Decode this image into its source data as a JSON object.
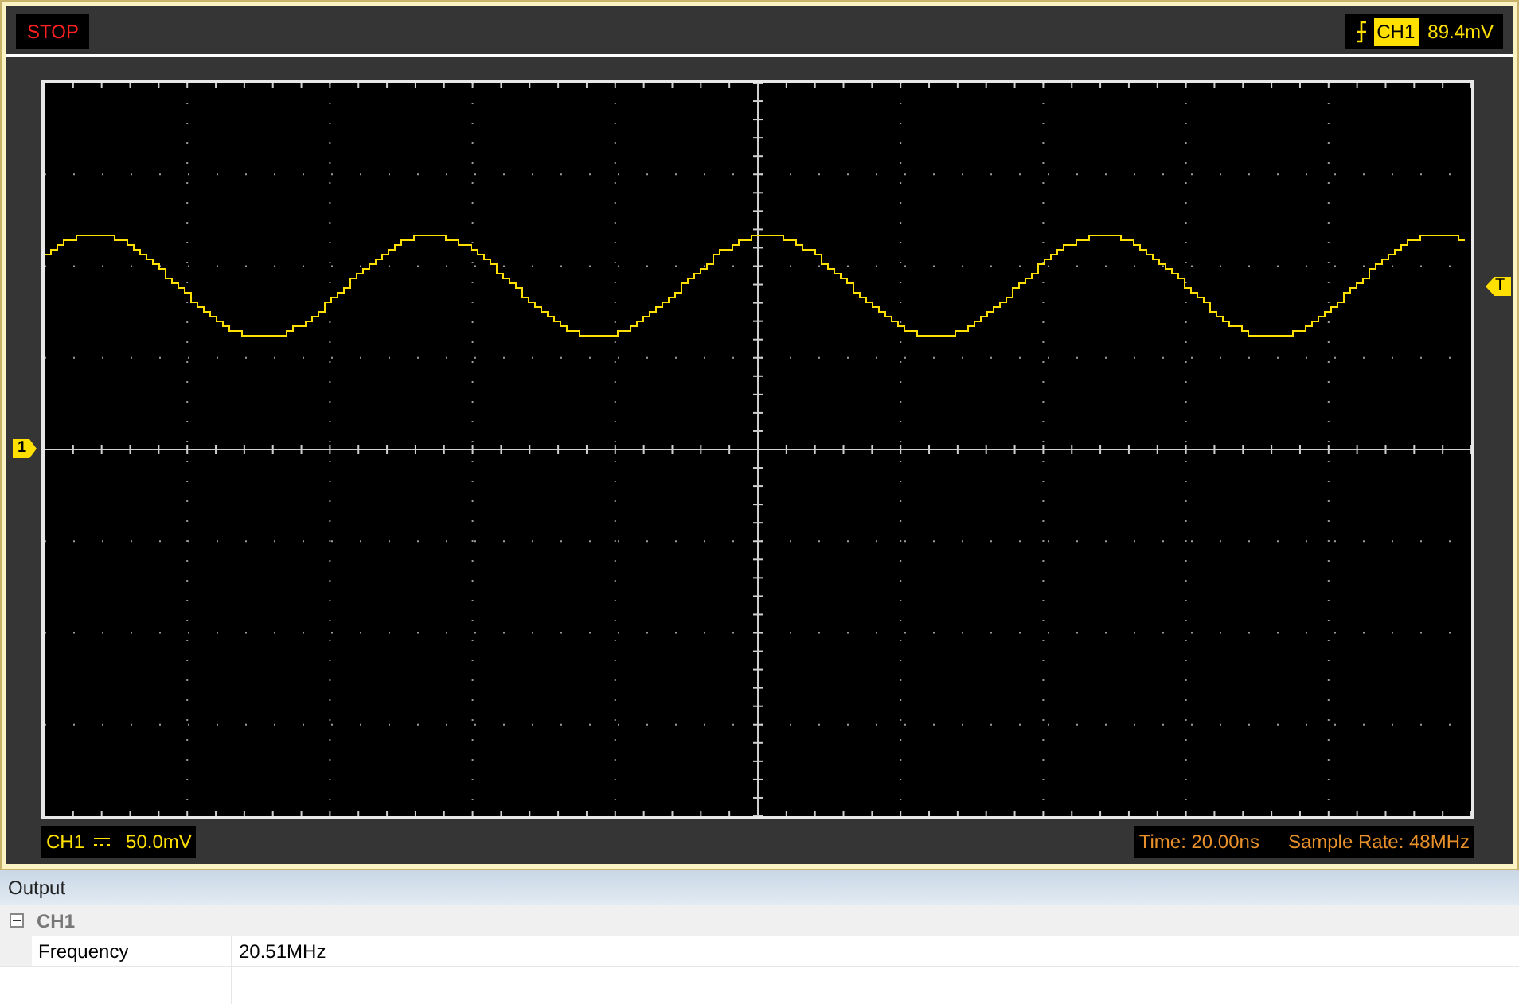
{
  "status": "STOP",
  "trigger": {
    "channel": "CH1",
    "level": "89.4mV"
  },
  "markers": {
    "channel": "1",
    "trigger": "T"
  },
  "channel_scale": {
    "channel": "CH1",
    "value": "50.0mV"
  },
  "time": "Time: 20.00ns",
  "sample_rate": "Sample Rate: 48MHz",
  "output": {
    "title": "Output",
    "group": {
      "name": "CH1",
      "expanded": true
    },
    "rows": [
      {
        "label": "Frequency",
        "value": "20.51MHz"
      }
    ]
  }
}
